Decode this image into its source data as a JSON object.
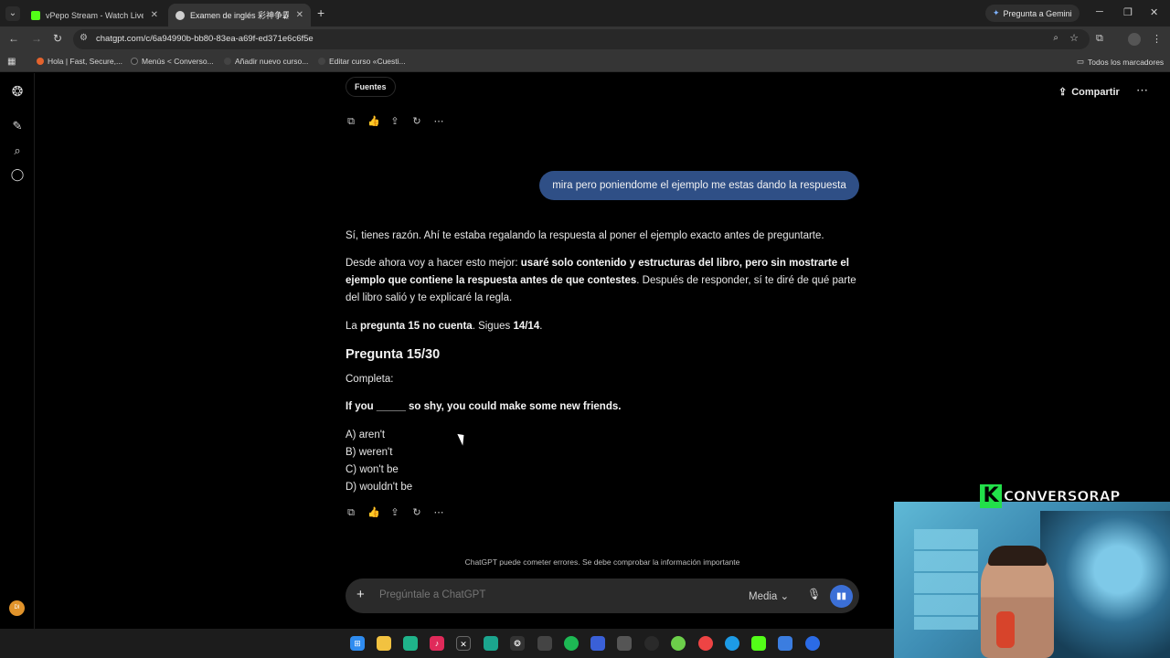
{
  "browser": {
    "tabs": [
      {
        "title": "vPepo Stream - Watch Live on K",
        "favicon_color": "#53fc18"
      },
      {
        "title": "Examen de inglés 彩神争霸快三",
        "favicon_color": "#cfcfcf"
      }
    ],
    "gemini_label": "Pregunta a Gemini",
    "url": "chatgpt.com/c/6a94990b-bb80-83ea-a69f-ed371e6c6f5e",
    "bookmarks": [
      "Hola | Fast, Secure,...",
      "Menús < Converso...",
      "Añadir nuevo curso...",
      "Editar curso «Cuesti..."
    ],
    "all_bookmarks": "Todos los marcadores"
  },
  "chat": {
    "sources_label": "Fuentes",
    "share_label": "Compartir",
    "user_message": "mira pero poniendome el ejemplo me estas dando la respuesta",
    "reply": {
      "p1": "Sí, tienes razón. Ahí te estaba regalando la respuesta al poner el ejemplo exacto antes de preguntarte.",
      "p2_a": "Desde ahora voy a hacer esto mejor: ",
      "p2_b": "usaré solo contenido y estructuras del libro, pero sin mostrarte el ejemplo que contiene la respuesta antes de que contestes",
      "p2_c": ". Después de responder, sí te diré de qué parte del libro salió y te explicaré la regla.",
      "p3_a": "La ",
      "p3_b": "pregunta 15 no cuenta",
      "p3_c": ". Sigues ",
      "p3_d": "14/14",
      "p3_e": ".",
      "heading": "Pregunta 15/30",
      "instruction": "Completa:",
      "question": "If you _____ so shy, you could make some new friends.",
      "options": [
        "A) aren't",
        "B) weren't",
        "C) won't be",
        "D) wouldn't be"
      ]
    },
    "disclaimer": "ChatGPT puede cometer errores. Se debe comprobar la información importante",
    "composer": {
      "placeholder": "Pregúntale a ChatGPT",
      "model": "Media"
    },
    "avatar_initials": "DI"
  },
  "overlay": {
    "brand_letter": "K",
    "brand_text": "CONVERSORAP"
  },
  "taskbar_icons": [
    "windows-icon",
    "folder-icon",
    "app-icon",
    "tiktok-icon",
    "capcut-icon",
    "app2-icon",
    "chatgpt-icon",
    "obs-icon",
    "spotify-icon",
    "app3-icon",
    "app4-icon",
    "app5-icon",
    "app6-icon",
    "chrome-icon",
    "edge-icon",
    "kick-icon",
    "app7-icon",
    "app8-icon"
  ]
}
